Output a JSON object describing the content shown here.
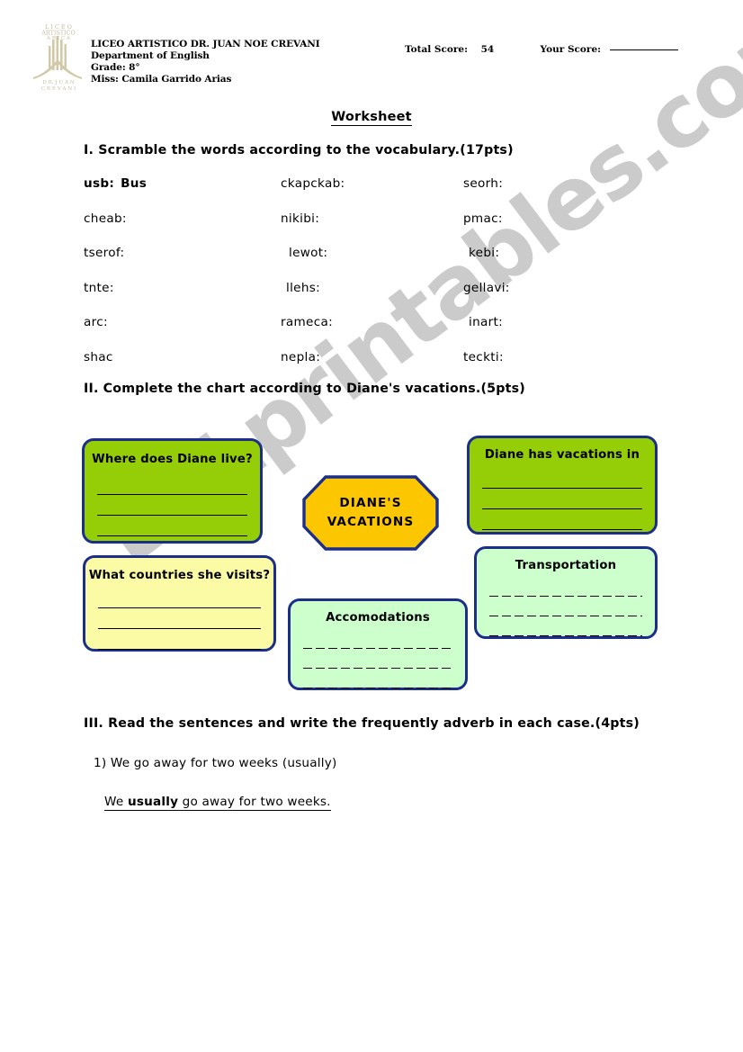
{
  "header": {
    "logo_name": "school-crest-logo",
    "school": "LICEO ARTISTICO DR. JUAN NOE CREVANI",
    "department": "Department of English",
    "grade": "Grade: 8°",
    "teacher": "Miss: Camila Garrido Arias",
    "total_score_label": "Total Score:",
    "total_score_value": "54",
    "your_score_label": "Your Score:",
    "your_score_value": ""
  },
  "title": "Worksheet",
  "watermark": "ESLprintables.com",
  "section1": {
    "heading": "I. Scramble the words according to the vocabulary.(17pts)",
    "rows": [
      [
        {
          "scrambled": "usb:",
          "answer": "Bus",
          "solved": true
        },
        {
          "scrambled": "ckapckab:",
          "answer": "",
          "solved": false
        },
        {
          "scrambled": "seorh:",
          "answer": "",
          "solved": false
        }
      ],
      [
        {
          "scrambled": "cheab:",
          "answer": "",
          "solved": false
        },
        {
          "scrambled": "nikibi:",
          "answer": "",
          "solved": false
        },
        {
          "scrambled": "pmac:",
          "answer": "",
          "solved": false
        }
      ],
      [
        {
          "scrambled": "tserof:",
          "answer": "",
          "solved": false
        },
        {
          "scrambled": "lewot:",
          "answer": "",
          "solved": false
        },
        {
          "scrambled": "kebi:",
          "answer": "",
          "solved": false
        }
      ],
      [
        {
          "scrambled": "tnte:",
          "answer": "",
          "solved": false
        },
        {
          "scrambled": "llehs:",
          "answer": "",
          "solved": false
        },
        {
          "scrambled": "gellavi:",
          "answer": "",
          "solved": false
        }
      ],
      [
        {
          "scrambled": "arc:",
          "answer": "",
          "solved": false
        },
        {
          "scrambled": "rameca:",
          "answer": "",
          "solved": false
        },
        {
          "scrambled": "inart:",
          "answer": "",
          "solved": false
        }
      ],
      [
        {
          "scrambled": "shac",
          "answer": "",
          "solved": false
        },
        {
          "scrambled": "nepla:",
          "answer": "",
          "solved": false
        },
        {
          "scrambled": "teckti:",
          "answer": "",
          "solved": false
        }
      ]
    ]
  },
  "section2": {
    "heading": "II. Complete the chart according to Diane's vacations.(5pts)",
    "center_line1": "DIANE'S",
    "center_line2": "VACATIONS",
    "nodes": {
      "live": {
        "label": "Where does Diane live?",
        "lines": 3,
        "color": "#95cd06"
      },
      "has": {
        "label": "Diane has vacations in",
        "lines": 3,
        "color": "#95cd06"
      },
      "countries": {
        "label": "What countries she visits?",
        "lines": 3,
        "color": "#fbfba6"
      },
      "transport": {
        "label": "Transportation",
        "lines": 3,
        "color": "#ccffcc"
      },
      "accommodations": {
        "label": "Accomodations",
        "lines": 3,
        "color": "#ccffcc"
      }
    },
    "border_color": "#1b2e8a",
    "center_color": "#fcc600"
  },
  "section3": {
    "heading": "III.  Read the sentences and write the frequently adverb in each case.(4pts)",
    "question": "1) We go away for two weeks (usually)",
    "answer_pre": "We ",
    "answer_bold": "usually",
    "answer_post": " go away for two weeks."
  }
}
